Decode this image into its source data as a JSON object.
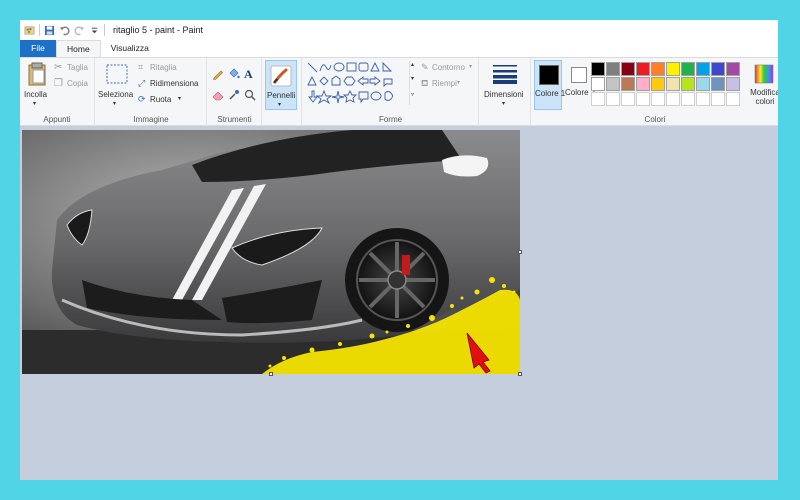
{
  "window": {
    "title": "ritaglio 5 - paint - Paint"
  },
  "tabs": [
    {
      "label": "File"
    },
    {
      "label": "Home"
    },
    {
      "label": "Visualizza"
    }
  ],
  "ribbon": {
    "appunti": {
      "paste": "Incolla",
      "cut": "Taglia",
      "copy": "Copia",
      "group": "Appunti"
    },
    "immagine": {
      "select": "Seleziona",
      "crop": "Ritaglia",
      "resize": "Ridimensiona",
      "rotate": "Ruota",
      "group": "Immagine"
    },
    "strumenti": {
      "group": "Strumenti",
      "text_tool": "A"
    },
    "pennelli": {
      "label": "Pennelli"
    },
    "forme": {
      "group": "Forme",
      "outline": "Contorno",
      "fill": "Riempi"
    },
    "dimensioni": {
      "label": "Dimensioni"
    },
    "colori": {
      "color1": "Colore 1",
      "color2": "Colore 2",
      "edit": "Modifica colori",
      "group": "Colori",
      "color1_value": "#000000",
      "color2_value": "#ffffff",
      "palette_row1": [
        "#000000",
        "#7f7f7f",
        "#880015",
        "#ed1c24",
        "#ff7f27",
        "#fff200",
        "#22b14c",
        "#00a2e8",
        "#3f48cc",
        "#a349a4"
      ],
      "palette_row2": [
        "#ffffff",
        "#c3c3c3",
        "#b97a57",
        "#ffaec9",
        "#ffc90e",
        "#efe4b0",
        "#b5e61d",
        "#99d9ea",
        "#7092be",
        "#c8bfe7"
      ],
      "palette_row3": [
        "#ffffff",
        "#ffffff",
        "#ffffff",
        "#ffffff",
        "#ffffff",
        "#ffffff",
        "#ffffff",
        "#ffffff",
        "#ffffff",
        "#ffffff"
      ]
    }
  },
  "accent": "#1e6fc6",
  "highlight_color": "#ffff00"
}
